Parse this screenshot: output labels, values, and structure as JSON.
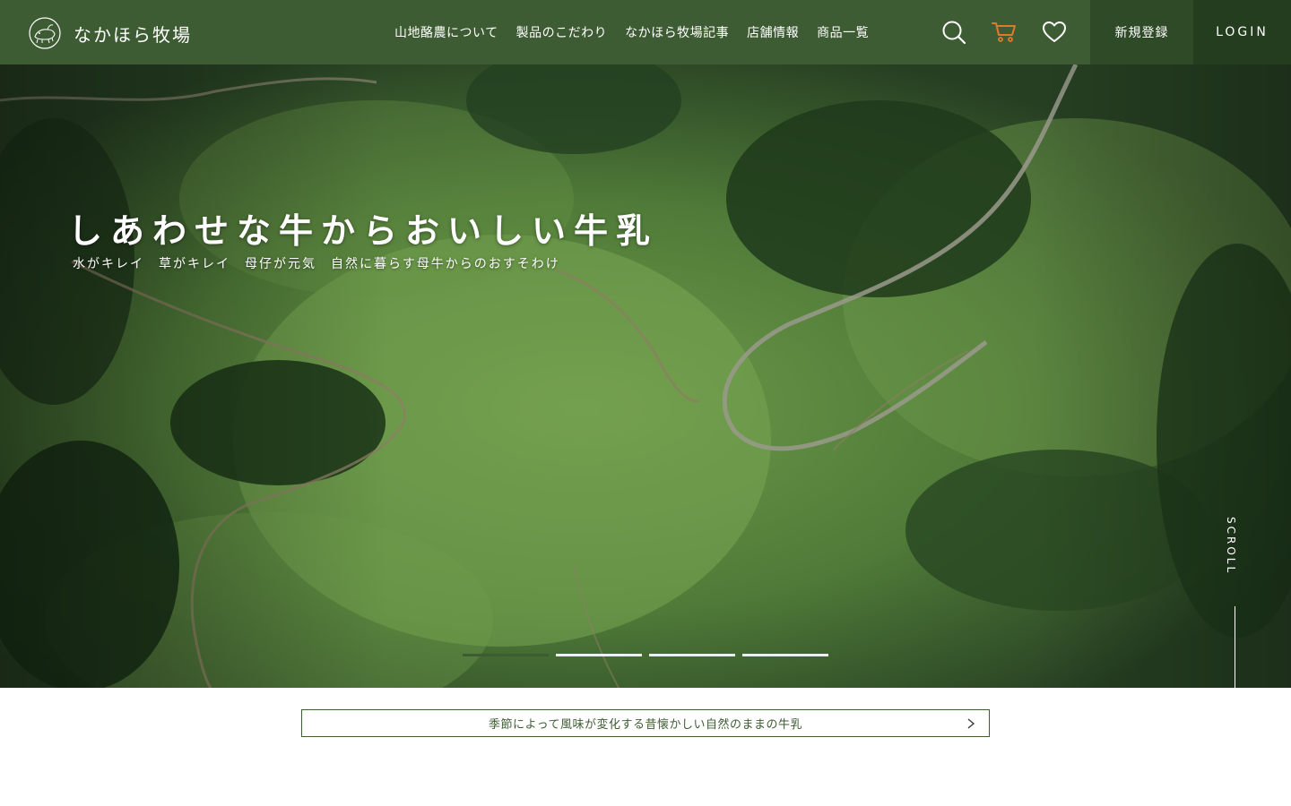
{
  "brand": {
    "name": "なかほら牧場",
    "logo_icon": "cow-logo-icon"
  },
  "nav": {
    "items": [
      {
        "label": "山地酪農について"
      },
      {
        "label": "製品のこだわり"
      },
      {
        "label": "なかほら牧場記事"
      },
      {
        "label": "店舗情報"
      },
      {
        "label": "商品一覧"
      }
    ]
  },
  "header_icons": {
    "search": "search-icon",
    "cart": "cart-icon",
    "favorites": "heart-icon"
  },
  "auth": {
    "register_label": "新規登録",
    "login_label": "LOGIN"
  },
  "hero": {
    "title": "しあわせな牛からおいしい牛乳",
    "subtitle": "水がキレイ　草がキレイ　母仔が元気　自然に暮らす母牛からのおすそわけ",
    "slide_count": 4,
    "active_slide": 1,
    "scroll_label": "SCROLL"
  },
  "notice": {
    "text": "季節によって風味が変化する昔懐かしい自然のままの牛乳"
  },
  "colors": {
    "header_bg": "#3e5c33",
    "register_bg": "#2f4a27",
    "login_bg": "#243d1e",
    "cart_icon": "#e07a2a",
    "accent": "#3e5c33"
  }
}
